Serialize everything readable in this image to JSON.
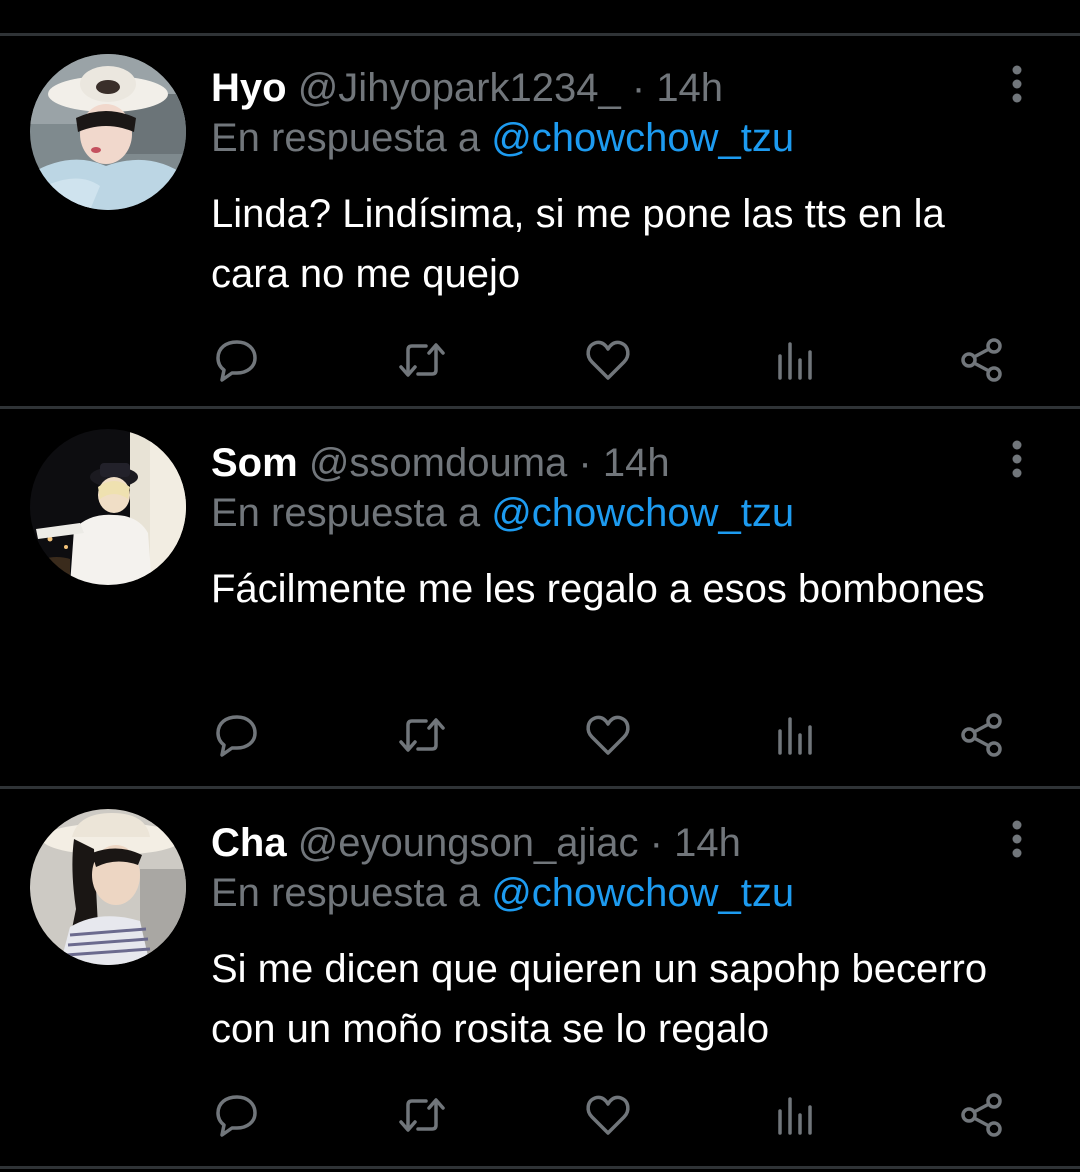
{
  "colors": {
    "background": "#000000",
    "divider": "#2f3336",
    "name": "#ffffff",
    "secondary_text": "#71767b",
    "mention": "#1d9bf0",
    "body_text": "#ffffff"
  },
  "icons": {
    "more": "more-vertical-icon",
    "reply": "reply-bubble-icon",
    "retweet": "retweet-icon",
    "like": "heart-icon",
    "stats": "analytics-bars-icon",
    "share": "share-icon"
  },
  "tweets": [
    {
      "name": "Hyo",
      "handle": "@Jihyopark1234_",
      "separator": "·",
      "time": "14h",
      "reply_prefix": "En respuesta a",
      "reply_to": "@chowchow_tzu",
      "text": "Linda? Lindísima, si me pone las tts en la cara no me quejo"
    },
    {
      "name": "Som",
      "handle": "@ssomdouma",
      "separator": "·",
      "time": "14h",
      "reply_prefix": "En respuesta a",
      "reply_to": "@chowchow_tzu",
      "text": "Fácilmente me les regalo a esos bombones"
    },
    {
      "name": "Cha",
      "handle": "@eyoungson_ajiac",
      "separator": "·",
      "time": "14h",
      "reply_prefix": "En respuesta a",
      "reply_to": "@chowchow_tzu",
      "text": "Si me dicen que quieren un sapohp becerro con un moño rosita se lo regalo"
    }
  ]
}
